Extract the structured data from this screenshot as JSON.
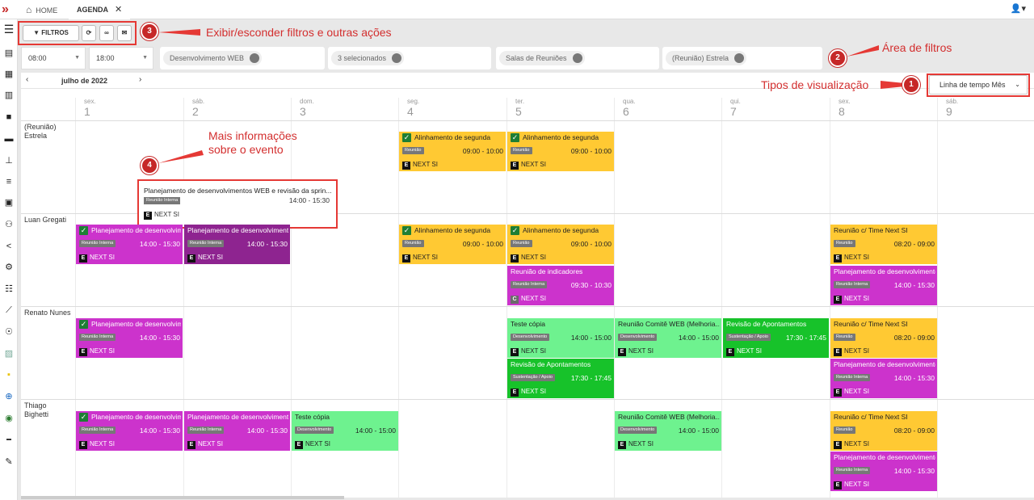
{
  "tabs": {
    "home": "HOME",
    "agenda": "AGENDA"
  },
  "toolbar": {
    "filters_label": "FILTROS"
  },
  "filters": {
    "time_from": "08:00",
    "time_to": "18:00",
    "pill1": "Desenvolvimento WEB",
    "pill2": "3 selecionados",
    "pill3": "Salas de Reuniões",
    "pill4": "(Reunião) Estrela"
  },
  "nav": {
    "month": "julho de 2022",
    "view": "Linha de tempo Mês"
  },
  "callouts": {
    "c1": "1",
    "c1_text": "Tipos de visualização",
    "c2": "2",
    "c2_text": "Área de filtros",
    "c3": "3",
    "c3_text": "Exibir/esconder filtros e outras ações",
    "c4": "4",
    "c4_text1": "Mais informações",
    "c4_text2": "sobre o evento"
  },
  "days": [
    {
      "wd": "sex.",
      "dn": "1"
    },
    {
      "wd": "sáb.",
      "dn": "2"
    },
    {
      "wd": "dom.",
      "dn": "3"
    },
    {
      "wd": "seg.",
      "dn": "4"
    },
    {
      "wd": "ter.",
      "dn": "5"
    },
    {
      "wd": "qua.",
      "dn": "6"
    },
    {
      "wd": "qui.",
      "dn": "7"
    },
    {
      "wd": "sex.",
      "dn": "8"
    },
    {
      "wd": "sáb.",
      "dn": "9"
    }
  ],
  "resources": [
    "(Reunião) Estrela",
    "Luan Gregati",
    "Renato Nunes",
    "Thiago Bighetti"
  ],
  "events": {
    "alinh_title": "Alinhamento de segunda",
    "alinh_tag": "Reunião",
    "alinh_time": "09:00 - 10:00",
    "planej_title": "Planejamento de desenvolvimentos WEB e revisão da sprint",
    "planej_short": "Planejamento de desenvolvi...",
    "planej_tag": "Reunião Interna",
    "planej_time": "14:00 - 15:30",
    "company": "NEXT SI",
    "e_badge": "E",
    "c_badge": "C",
    "indic_title": "Reunião de indicadores",
    "indic_time": "09:30 - 10:30",
    "time_title": "Reunião c/ Time Next SI",
    "time_time": "08:20 - 09:00",
    "teste_title": "Teste cópia",
    "dev_tag": "Desenvolvimento",
    "teste_time": "14:00 - 15:00",
    "revisao_title": "Revisão de Apontamentos",
    "sust_tag": "Sustentação / Apoio",
    "revisao_time": "17:30 - 17:45",
    "comite_title": "Reunião Comitê WEB (Melhoria...",
    "comite_time": "14:00 - 15:00"
  },
  "popup": {
    "title": "Planejamento de desenvolvimentos WEB e revisão da sprin...",
    "tag": "Reunião Interna",
    "time": "14:00 - 15:30",
    "company": "NEXT SI"
  }
}
